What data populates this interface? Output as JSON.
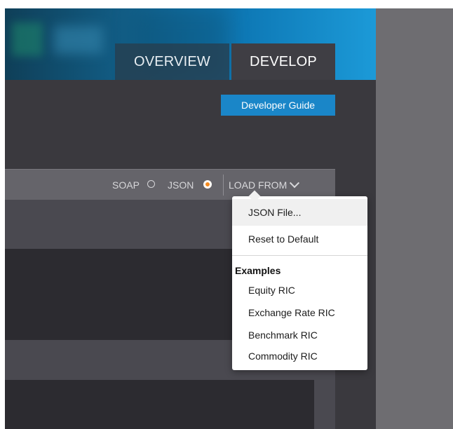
{
  "header": {
    "tabs": [
      {
        "label": "OVERVIEW",
        "active": false
      },
      {
        "label": "DEVELOP",
        "active": true
      }
    ]
  },
  "toolbar": {
    "developer_guide_label": "Developer Guide",
    "format_options": [
      {
        "label": "SOAP",
        "selected": false
      },
      {
        "label": "JSON",
        "selected": true
      }
    ],
    "load_from_label": "LOAD FROM",
    "load_from_icon": "chevron-down-icon"
  },
  "load_menu": {
    "items": [
      {
        "label": "JSON File..."
      },
      {
        "label": "Reset to Default"
      }
    ],
    "examples_heading": "Examples",
    "examples": [
      {
        "label": "Equity RIC"
      },
      {
        "label": "Exchange Rate RIC"
      },
      {
        "label": "Benchmark RIC"
      },
      {
        "label": "Commodity RIC"
      }
    ]
  },
  "colors": {
    "accent_blue": "#1a86c8",
    "radio_selected": "#f48a1f",
    "panel_dark": "#3a393e",
    "editor_bg": "#2c2b30"
  }
}
